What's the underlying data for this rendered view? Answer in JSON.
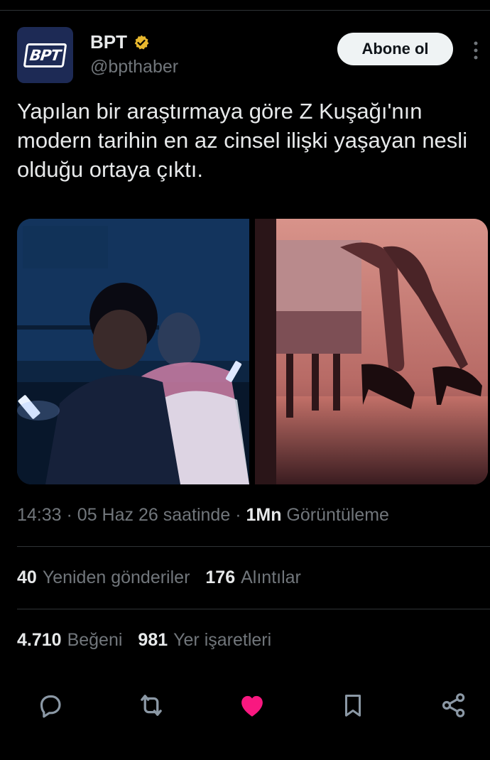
{
  "account": {
    "display_name": "BPT",
    "handle": "@bpthaber",
    "avatar_text": "BPT",
    "verified": true,
    "verified_color": "#e8b82e",
    "follow_label": "Abone ol"
  },
  "tweet": {
    "text": "Yapılan bir araştırmaya göre Z Kuşağı'nın modern tarihin en az cinsel ilişki yaşayan nesli olduğu ortaya çıktı.",
    "time": "14:33",
    "date": "05 Haz 26 saatinde",
    "separator": "·",
    "views_count": "1Mn",
    "views_label": "Görüntüleme"
  },
  "stats": {
    "retweets_count": "40",
    "retweets_label": "Yeniden gönderiler",
    "quotes_count": "176",
    "quotes_label": "Alıntılar",
    "likes_count": "4.710",
    "likes_label": "Beğeni",
    "bookmarks_count": "981",
    "bookmarks_label": "Yer işaretleri"
  },
  "actions": {
    "reply_icon": "reply-icon",
    "retweet_icon": "retweet-icon",
    "like_icon": "heart-icon",
    "like_color": "#f91880",
    "bookmark_icon": "bookmark-icon",
    "share_icon": "share-icon"
  }
}
